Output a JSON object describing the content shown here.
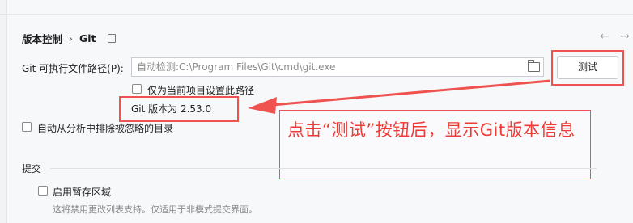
{
  "breadcrumb": {
    "parent": "版本控制",
    "separator": "›",
    "current": "Git"
  },
  "nav": {
    "back_icon": "←",
    "forward_icon": "→"
  },
  "git_path": {
    "label": "Git 可执行文件路径(P):",
    "placeholder": "自动检测:C:\\Program Files\\Git\\cmd\\git.exe",
    "test_button": "测试"
  },
  "options": {
    "current_project_only": "仅为当前项目设置此路径",
    "git_version": "Git 版本为 2.53.0",
    "auto_exclude_ignored": "自动从分析中排除被忽略的目录"
  },
  "annotation": {
    "text": "点击“测试”按钮后，显示Git版本信息",
    "color": "#ef3b36"
  },
  "commit": {
    "section_title": "提交",
    "staging_area": "启用暂存区域",
    "hint": "这将禁用更改列表支持。仅适用于非模式提交界面。"
  }
}
